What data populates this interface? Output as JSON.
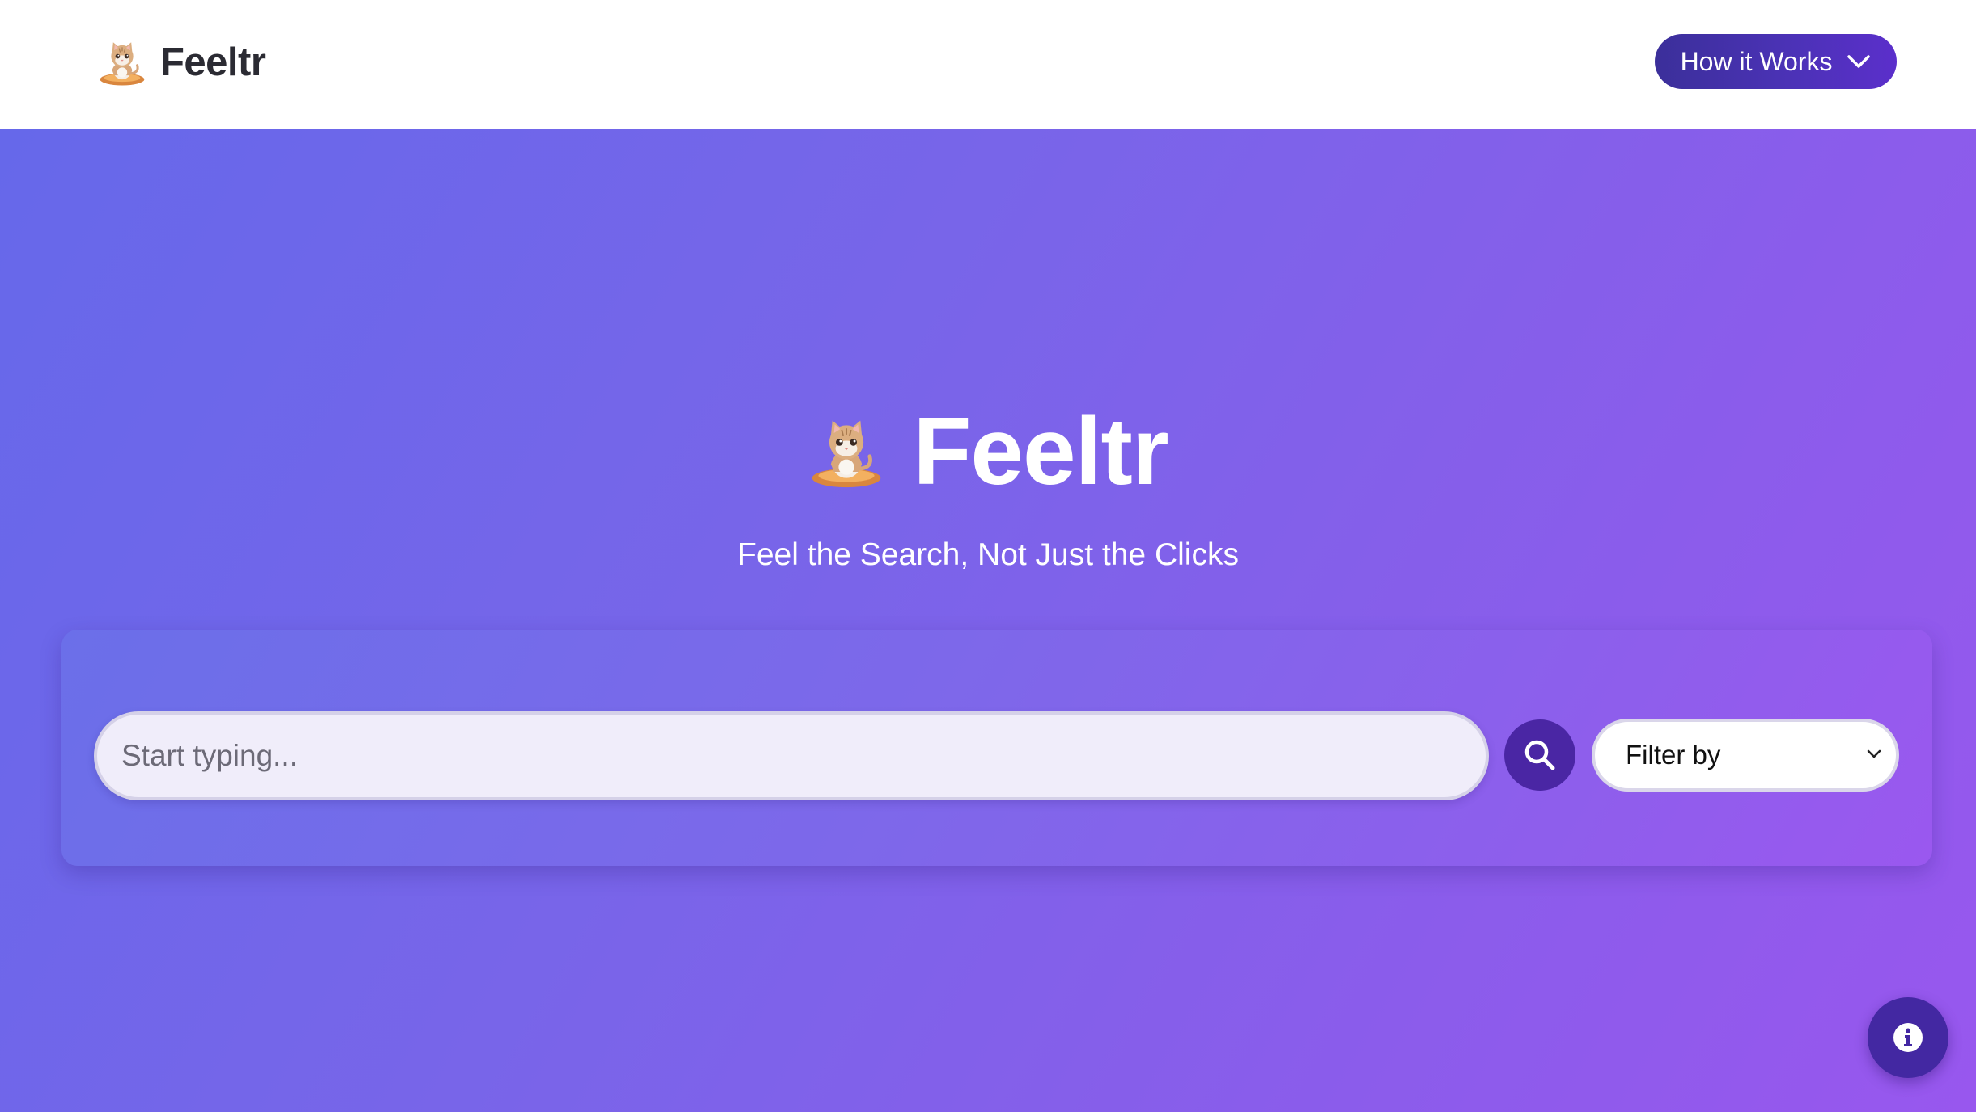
{
  "header": {
    "brand_name": "Feeltr",
    "brand_icon": "cat-mascot-icon",
    "how_it_works_label": "How it Works",
    "how_it_works_icon": "chevron-down-icon"
  },
  "hero": {
    "title": "Feeltr",
    "title_icon": "cat-mascot-icon",
    "tagline": "Feel the Search, Not Just the Clicks"
  },
  "search": {
    "placeholder": "Start typing...",
    "value": "",
    "button_icon": "search-icon",
    "filter_selected": "Filter by",
    "filter_icon": "chevron-down-icon"
  },
  "info_button": {
    "icon": "info-icon"
  },
  "colors": {
    "accent": "#4a26a4",
    "header_button": "#4b32b6",
    "hero_gradient_start": "#6668ea",
    "hero_gradient_end": "#9857ee"
  }
}
